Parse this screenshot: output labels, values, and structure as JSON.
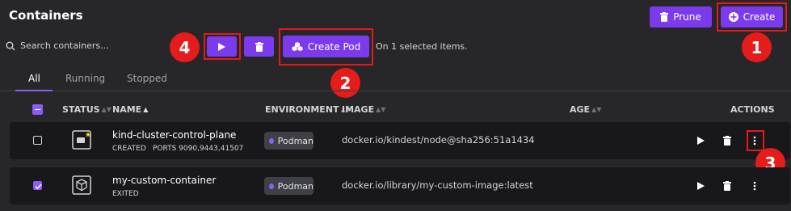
{
  "page": {
    "title": "Containers"
  },
  "header": {
    "prune_label": "Prune",
    "create_label": "Create"
  },
  "search": {
    "placeholder": "Search containers..."
  },
  "toolbar": {
    "create_pod_label": "Create Pod",
    "selection_text": "On 1 selected items."
  },
  "tabs": [
    {
      "label": "All",
      "active": true
    },
    {
      "label": "Running",
      "active": false
    },
    {
      "label": "Stopped",
      "active": false
    }
  ],
  "table": {
    "headers": {
      "status": "STATUS",
      "name": "NAME",
      "environment": "ENVIRONMENT",
      "image": "IMAGE",
      "age": "AGE",
      "actions": "ACTIONS"
    },
    "rows": [
      {
        "selected": false,
        "name": "kind-cluster-control-plane",
        "state": "CREATED",
        "ports": "PORTS 9090,9443,41507",
        "environment": "Podman",
        "image": "docker.io/kindest/node@sha256:51a1434",
        "status_icon": "container-starred-icon"
      },
      {
        "selected": true,
        "name": "my-custom-container",
        "state": "EXITED",
        "ports": "",
        "environment": "Podman",
        "image": "docker.io/library/my-custom-image:latest",
        "status_icon": "container-cube-icon"
      }
    ]
  },
  "annotations": [
    "1",
    "2",
    "3",
    "4"
  ],
  "colors": {
    "accent": "#7c3aed",
    "background": "#27272a",
    "row": "#18181b",
    "annotation": "#e61b1b"
  }
}
